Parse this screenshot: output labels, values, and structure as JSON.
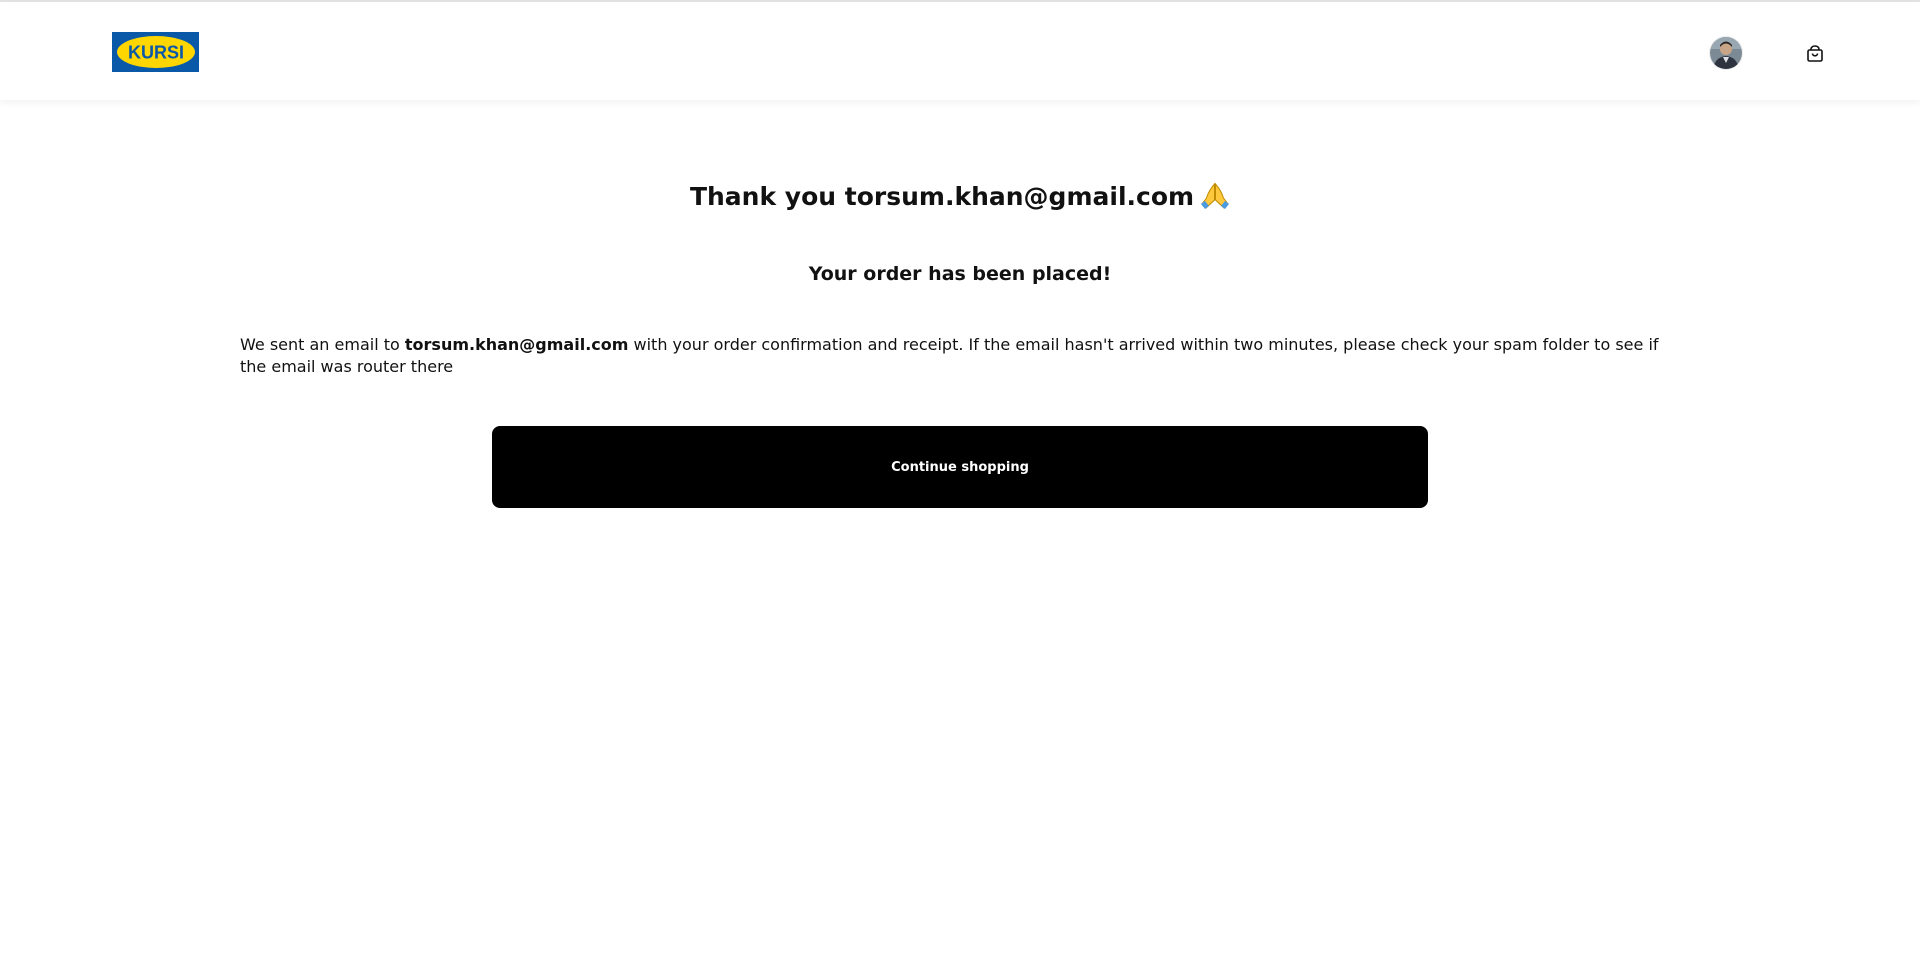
{
  "header": {
    "logo_text": "KURSI",
    "avatar_icon": "user-avatar",
    "cart_icon": "shopping-bag-icon"
  },
  "confirmation": {
    "title_prefix": "Thank you",
    "title_email": "torsum.khan@gmail.com",
    "title_icon": "folded-hands-emoji",
    "subtitle": "Your order has been placed!",
    "message_before": "We sent an email to",
    "message_email": "torsum.khan@gmail.com",
    "message_after": "with your order confirmation and receipt. If the email hasn't arrived within two minutes, please check your spam folder to see if the email was router there",
    "button_label": "Continue shopping"
  },
  "colors": {
    "brand_blue": "#0a58a8",
    "brand_yellow": "#ffd600",
    "button_bg": "#000000",
    "button_text": "#ffffff"
  }
}
